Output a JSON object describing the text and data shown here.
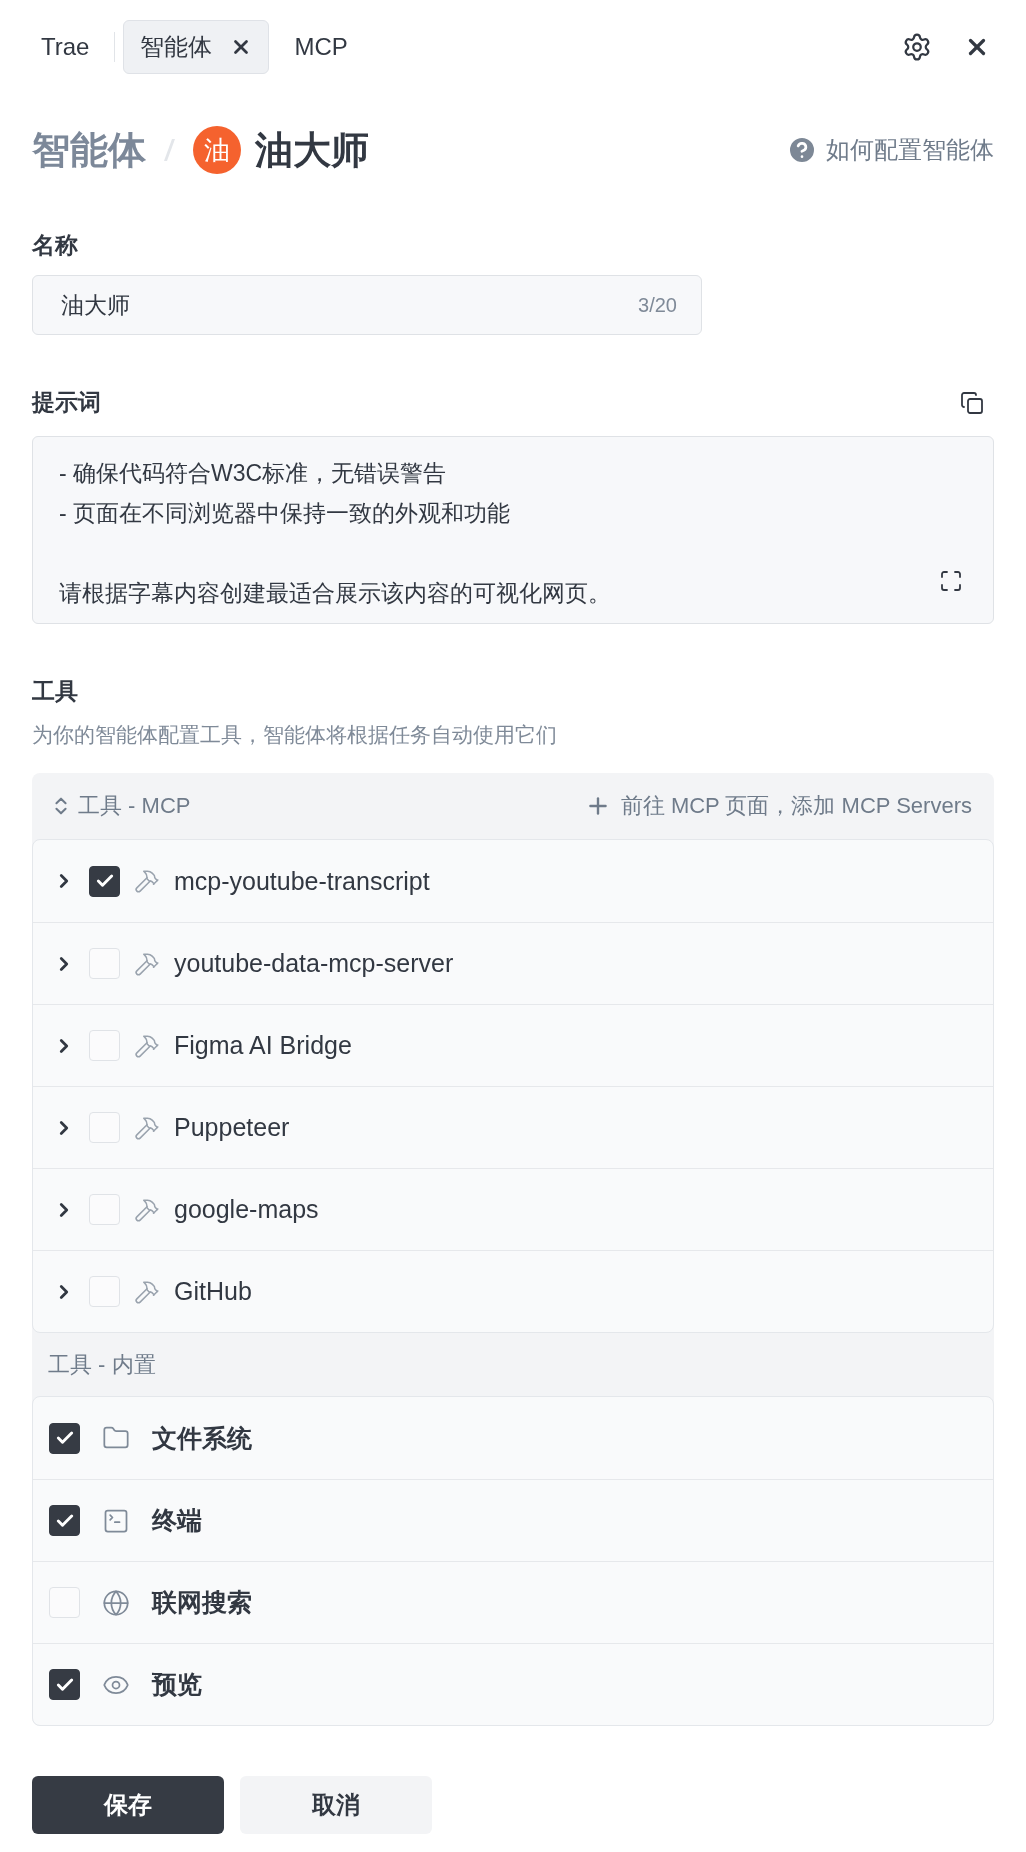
{
  "tabs": [
    {
      "label": "Trae",
      "selected": false,
      "closable": false
    },
    {
      "label": "智能体",
      "selected": true,
      "closable": true
    },
    {
      "label": "MCP",
      "selected": false,
      "closable": false
    }
  ],
  "breadcrumb": {
    "parent": "智能体",
    "avatar": "油",
    "name": "油大师"
  },
  "help_link": "如何配置智能体",
  "name_field": {
    "label": "名称",
    "value": "油大师",
    "counter": "3/20"
  },
  "prompt": {
    "label": "提示词",
    "paragraphs": [
      [
        "- 确保代码符合W3C标准，无错误警告",
        "- 页面在不同浏览器中保持一致的外观和功能"
      ],
      [
        "请根据字幕内容创建最适合展示该内容的可视化网页。"
      ]
    ]
  },
  "tools": {
    "title": "工具",
    "description": "为你的智能体配置工具，智能体将根据任务自动使用它们",
    "mcp": {
      "title": "工具 - MCP",
      "add_link": "前往 MCP 页面，添加 MCP Servers",
      "items": [
        {
          "name": "mcp-youtube-transcript",
          "checked": true
        },
        {
          "name": "youtube-data-mcp-server",
          "checked": false
        },
        {
          "name": "Figma AI Bridge",
          "checked": false
        },
        {
          "name": "Puppeteer",
          "checked": false
        },
        {
          "name": "google-maps",
          "checked": false
        },
        {
          "name": "GitHub",
          "checked": false
        }
      ]
    },
    "builtin": {
      "title": "工具 - 内置",
      "items": [
        {
          "name": "文件系统",
          "kind": "folder",
          "checked": true
        },
        {
          "name": "终端",
          "kind": "terminal",
          "checked": true
        },
        {
          "name": "联网搜索",
          "kind": "globe",
          "checked": false
        },
        {
          "name": "预览",
          "kind": "eye",
          "checked": true
        }
      ]
    }
  },
  "buttons": [
    {
      "label": "保存",
      "kind": "primary"
    },
    {
      "label": "取消",
      "kind": "secondary"
    }
  ]
}
